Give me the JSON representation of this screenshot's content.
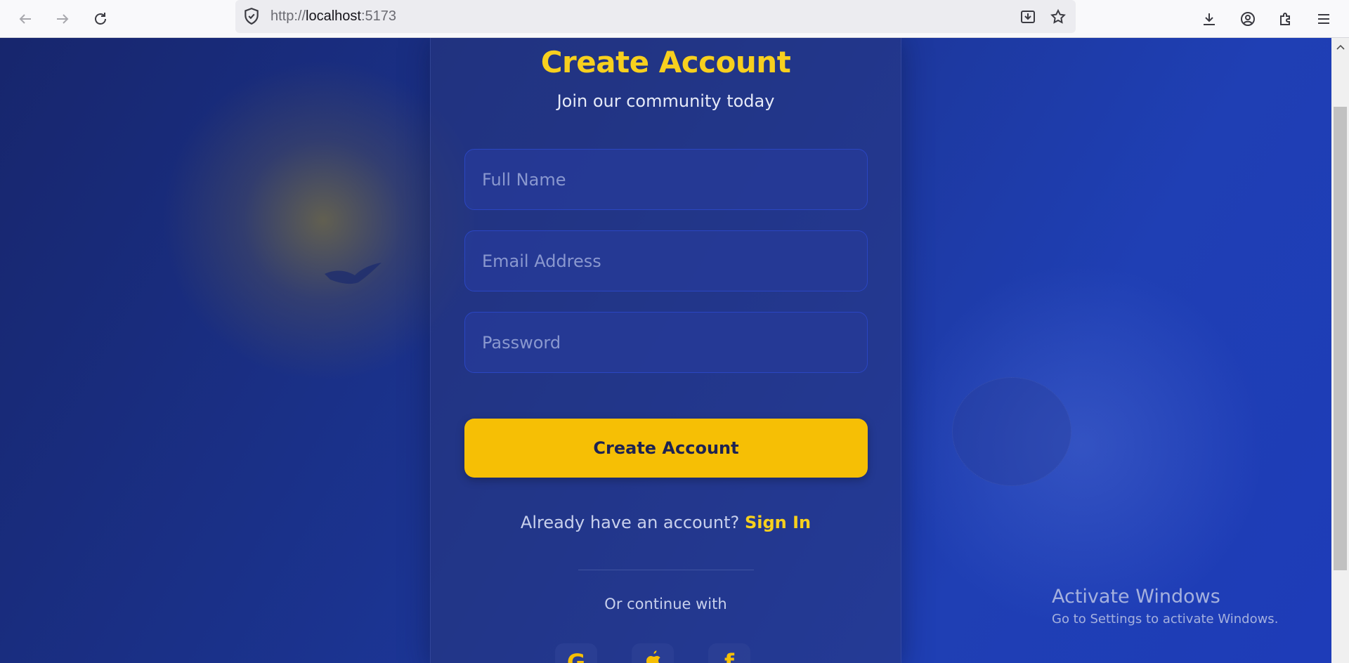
{
  "browser": {
    "url_scheme": "http://",
    "url_host": "localhost",
    "url_port": ":5173"
  },
  "form": {
    "title": "Create Account",
    "subtitle": "Join our community today",
    "full_name_placeholder": "Full Name",
    "email_placeholder": "Email Address",
    "password_placeholder": "Password",
    "submit_label": "Create Account",
    "already_text": "Already have an account?",
    "sign_in_label": "Sign In",
    "continue_with": "Or continue with",
    "social": [
      {
        "name": "google-icon",
        "glyph": "G"
      },
      {
        "name": "apple-icon",
        "glyph": ""
      },
      {
        "name": "facebook-icon",
        "glyph": "f"
      }
    ]
  },
  "os_overlay": {
    "title": "Activate Windows",
    "subtitle": "Go to Settings to activate Windows."
  },
  "colors": {
    "accent": "#f6bf05",
    "title_yellow": "#f7d01e",
    "background_blue": "#1b338f"
  }
}
